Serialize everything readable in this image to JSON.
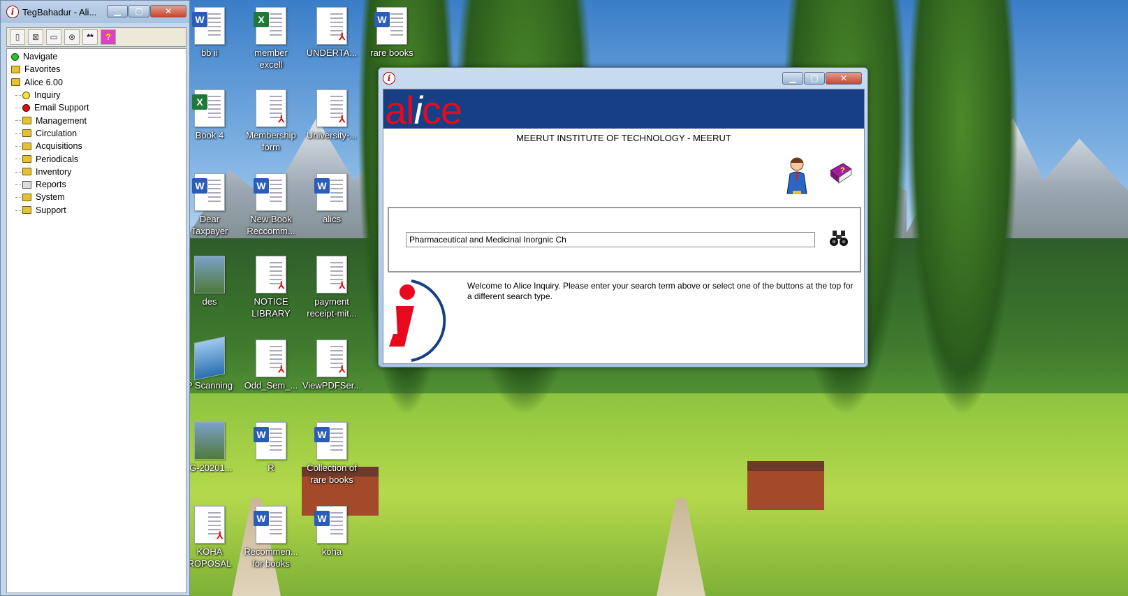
{
  "explorer": {
    "title": "TegBahadur - Ali...",
    "tree": [
      {
        "label": "Navigate",
        "icon": "green-dot-icon",
        "level": 1
      },
      {
        "label": "Favorites",
        "icon": "folder-icon",
        "level": 1
      },
      {
        "label": "Alice 6.00",
        "icon": "folder-icon",
        "level": 1
      },
      {
        "label": "Inquiry",
        "icon": "yellow-dot-icon",
        "level": 2
      },
      {
        "label": "Email Support",
        "icon": "red-dot-icon",
        "level": 2
      },
      {
        "label": "Management",
        "icon": "folder-icon",
        "level": 2
      },
      {
        "label": "Circulation",
        "icon": "folder-icon",
        "level": 2
      },
      {
        "label": "Acquisitions",
        "icon": "folder-icon",
        "level": 2
      },
      {
        "label": "Periodicals",
        "icon": "folder-icon",
        "level": 2
      },
      {
        "label": "Inventory",
        "icon": "folder-icon",
        "level": 2
      },
      {
        "label": "Reports",
        "icon": "printer-icon",
        "level": 2
      },
      {
        "label": "System",
        "icon": "folder-icon",
        "level": 2
      },
      {
        "label": "Support",
        "icon": "folder-icon",
        "level": 2
      }
    ]
  },
  "desktop_icons": [
    {
      "label": "bb ii",
      "type": "word"
    },
    {
      "label": "member excell",
      "type": "excel"
    },
    {
      "label": "UNDERTA...",
      "type": "pdf"
    },
    {
      "label": "rare books",
      "type": "word"
    },
    {
      "label": "Book 4",
      "type": "excel"
    },
    {
      "label": "Membership form",
      "type": "pdf"
    },
    {
      "label": "University-...",
      "type": "pdf"
    },
    {
      "label": "Dear Taxpayer",
      "type": "word"
    },
    {
      "label": "New Book Reccomm...",
      "type": "word"
    },
    {
      "label": "alics",
      "type": "word"
    },
    {
      "label": "des",
      "type": "image"
    },
    {
      "label": "NOTICE LIBRARY",
      "type": "pdf"
    },
    {
      "label": "payment receipt-mit...",
      "type": "pdf"
    },
    {
      "label": "P Scanning",
      "type": "scanner"
    },
    {
      "label": "Odd_Sem_...",
      "type": "pdf"
    },
    {
      "label": "ViewPDFSer...",
      "type": "pdf"
    },
    {
      "label": "IG-20201...",
      "type": "image"
    },
    {
      "label": "R",
      "type": "word"
    },
    {
      "label": "Collection of rare books",
      "type": "word"
    },
    {
      "label": "KOHA ROPOSAL",
      "type": "pdf"
    },
    {
      "label": "Recommen... for books",
      "type": "word"
    },
    {
      "label": "koha",
      "type": "word"
    }
  ],
  "inquiry": {
    "logo_left": "al",
    "logo_i": "i",
    "logo_right": "ce",
    "institution": "MEERUT INSTITUTE OF TECHNOLOGY - MEERUT",
    "search_value": "Pharmaceutical and Medicinal Inorgnic Ch",
    "welcome": "Welcome to Alice Inquiry.  Please enter your search term above or select one of the buttons at the top for a different search type."
  },
  "colors": {
    "banner": "#173f86",
    "logo_red": "#e8091e",
    "close_red": "#c9462f"
  }
}
